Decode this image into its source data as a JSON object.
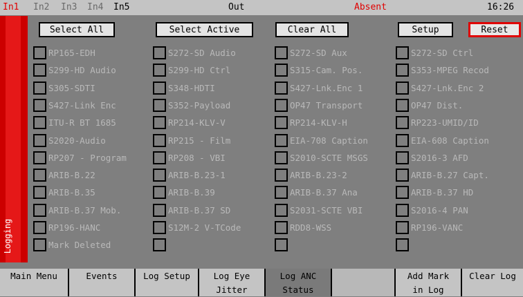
{
  "header": {
    "inputs": [
      "In1",
      "In2",
      "In3",
      "In4",
      "In5"
    ],
    "out_label": "Out",
    "status": "Absent",
    "time": "16:26"
  },
  "side_label": "Logging",
  "buttons": {
    "select_all": "Select All",
    "select_active": "Select Active",
    "clear_all": "Clear All",
    "setup": "Setup",
    "reset": "Reset"
  },
  "grid": {
    "columns": [
      [
        "RP165-EDH",
        "S299-HD Audio",
        "S305-SDTI",
        "S427-Link Enc",
        "ITU-R BT 1685",
        "S2020-Audio",
        "RP207 - Program",
        "ARIB-B.22",
        "ARIB-B.35",
        "ARIB-B.37 Mob.",
        "RP196-HANC",
        "Mark Deleted"
      ],
      [
        "S272-SD Audio",
        "S299-HD Ctrl",
        "S348-HDTI",
        "S352-Payload",
        "RP214-KLV-V",
        "RP215 - Film",
        "RP208 - VBI",
        "ARIB-B.23-1",
        "ARIB-B.39",
        "ARIB-B.37 SD",
        "S12M-2 V-TCode",
        ""
      ],
      [
        "S272-SD Aux",
        "S315-Cam. Pos.",
        "S427-Lnk.Enc 1",
        "OP47 Transport",
        "RP214-KLV-H",
        "EIA-708 Caption",
        "S2010-SCTE MSGS",
        "ARIB-B.23-2",
        "ARIB-B.37 Ana",
        "S2031-SCTE VBI",
        "RDD8-WSS",
        ""
      ],
      [
        "S272-SD Ctrl",
        "S353-MPEG Recod",
        "S427-Lnk.Enc 2",
        "OP47 Dist.",
        "RP223-UMID/ID",
        "EIA-608 Caption",
        "S2016-3 AFD",
        "ARIB-B.27 Capt.",
        "ARIB-B.37 HD",
        "S2016-4 PAN",
        "RP196-VANC",
        ""
      ]
    ]
  },
  "tabs": [
    {
      "line1": "Main Menu",
      "line2": ""
    },
    {
      "line1": "Events",
      "line2": ""
    },
    {
      "line1": "Log Setup",
      "line2": ""
    },
    {
      "line1": "Log Eye",
      "line2": "Jitter"
    },
    {
      "line1": "Log ANC",
      "line2": "Status"
    },
    {
      "line1": "",
      "line2": ""
    },
    {
      "line1": "Add Mark",
      "line2": "in Log"
    },
    {
      "line1": "Clear Log",
      "line2": ""
    }
  ]
}
